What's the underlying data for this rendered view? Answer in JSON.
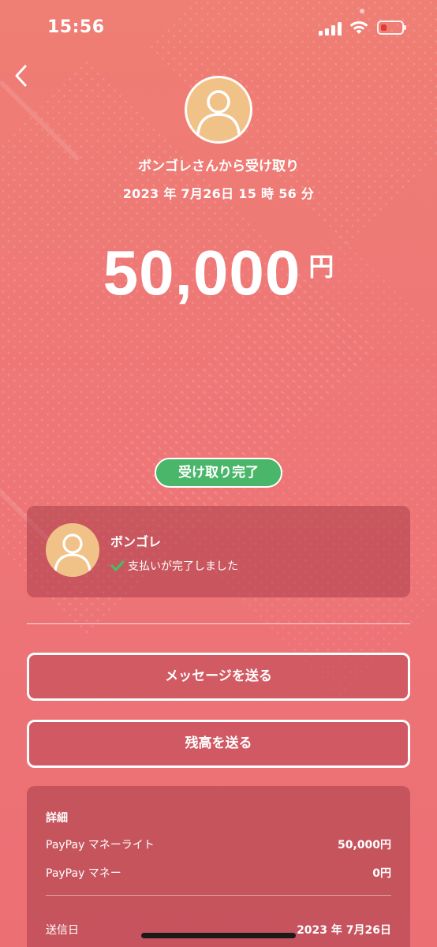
{
  "status_bar": {
    "time": "15:56"
  },
  "header": {
    "back_icon": "chevron-left-icon",
    "title": "ボンゴレさんから受け取り",
    "datetime": "2023 年 7月26日 15 時 56 分"
  },
  "amount": {
    "value": "50,000",
    "currency": "円"
  },
  "status_badge": {
    "label": "受け取り完了",
    "color": "#49b66a"
  },
  "payer": {
    "name": "ボンゴレ",
    "status": "支払いが完了しました",
    "status_icon": "check-icon"
  },
  "actions": {
    "message_label": "メッセージを送る",
    "balance_label": "残高を送る"
  },
  "details": {
    "heading": "詳細",
    "rows": [
      {
        "label": "PayPay マネーライト",
        "value": "50,000円"
      },
      {
        "label": "PayPay マネー",
        "value": "0円"
      }
    ],
    "sent_date": {
      "label": "送信日",
      "value": "2023 年 7月26日"
    }
  },
  "colors": {
    "background": "#ee7677",
    "avatar": "#f1c287",
    "success": "#49b66a"
  }
}
